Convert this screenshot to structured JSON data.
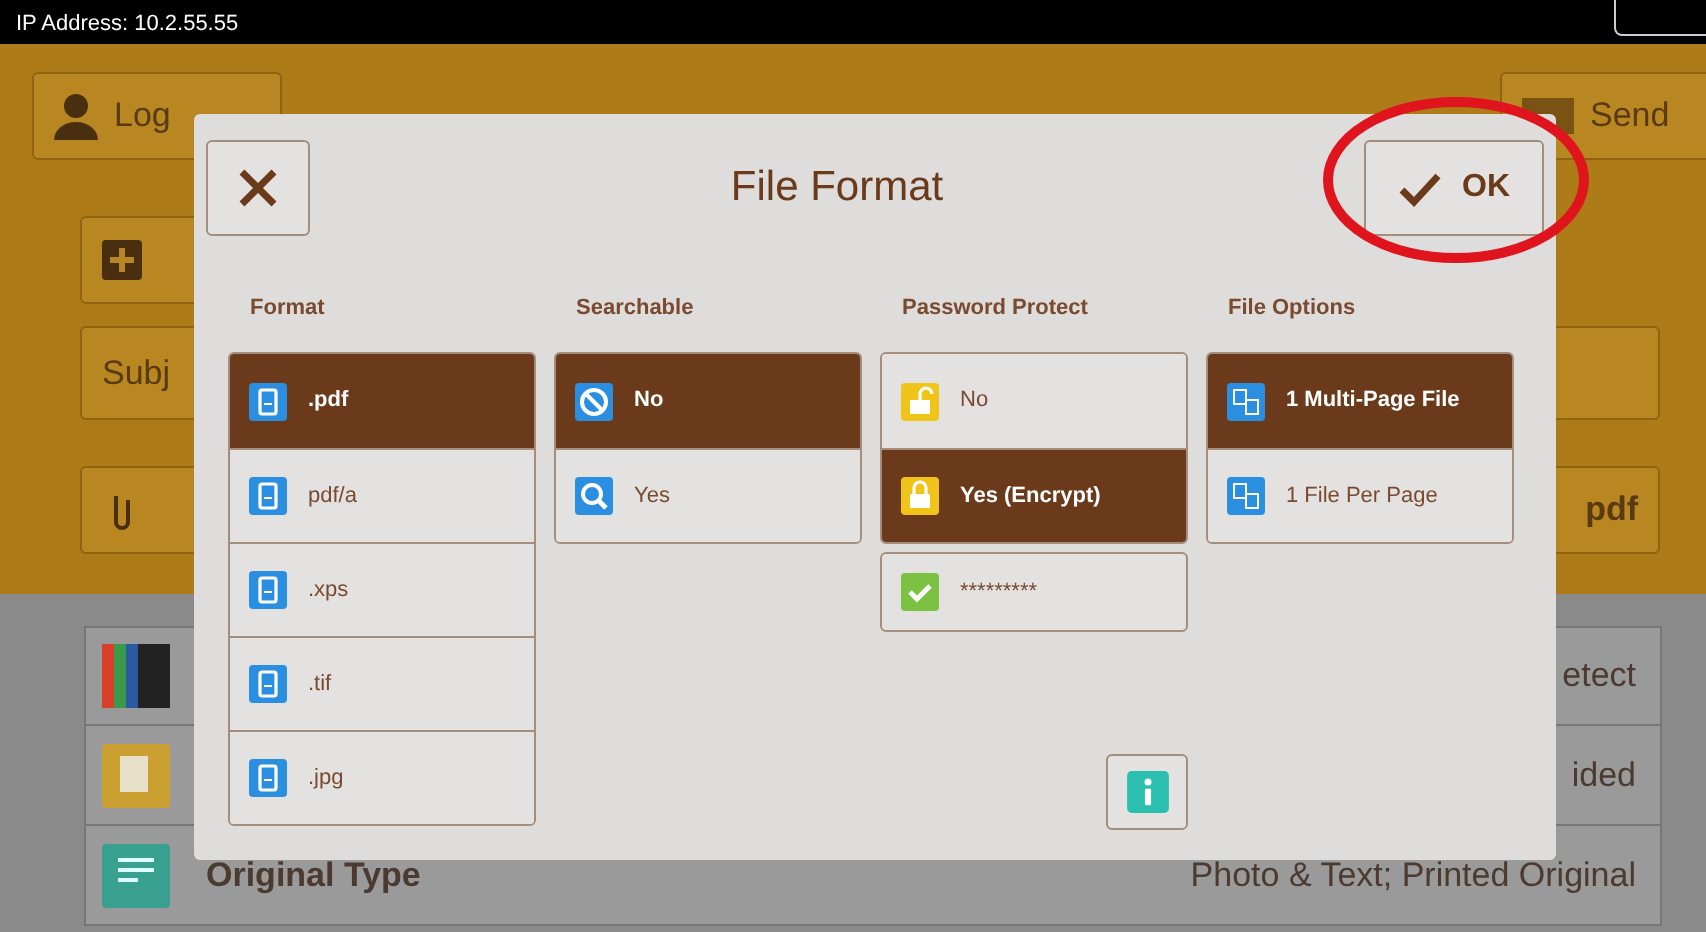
{
  "status_bar": {
    "ip_address": "IP Address: 10.2.55.55"
  },
  "background": {
    "login_button": "Log",
    "send_button": "Send",
    "subject_label": "Subj",
    "attachment_value": "pdf",
    "settings_rows": [
      {
        "kind": "color",
        "value": "etect"
      },
      {
        "kind": "page",
        "value": "ided"
      },
      {
        "kind": "original",
        "label": "Original Type",
        "value": "Photo & Text; Printed Original"
      }
    ]
  },
  "dialog": {
    "title": "File Format",
    "ok_button": "OK",
    "columns": [
      {
        "heading": "Format",
        "options": [
          {
            "label": ".pdf",
            "kind": "document",
            "selected": true
          },
          {
            "label": "pdf/a",
            "kind": "document",
            "selected": false
          },
          {
            "label": ".xps",
            "kind": "document",
            "selected": false
          },
          {
            "label": ".tif",
            "kind": "document",
            "selected": false
          },
          {
            "label": ".jpg",
            "kind": "document",
            "selected": false
          }
        ]
      },
      {
        "heading": "Searchable",
        "options": [
          {
            "label": "No",
            "kind": "no",
            "selected": true
          },
          {
            "label": "Yes",
            "kind": "search",
            "selected": false
          }
        ]
      },
      {
        "heading": "Password Protect",
        "options": [
          {
            "label": "No",
            "kind": "unlock",
            "selected": false
          },
          {
            "label": "Yes (Encrypt)",
            "kind": "lock",
            "selected": true
          }
        ],
        "password": "*********"
      },
      {
        "heading": "File Options",
        "options": [
          {
            "label": "1 Multi-Page File",
            "kind": "pages",
            "selected": true
          },
          {
            "label": "1 File Per Page",
            "kind": "pages",
            "selected": false
          }
        ]
      }
    ]
  },
  "annotation": {
    "kind": "circle",
    "color": "#e0141c"
  }
}
